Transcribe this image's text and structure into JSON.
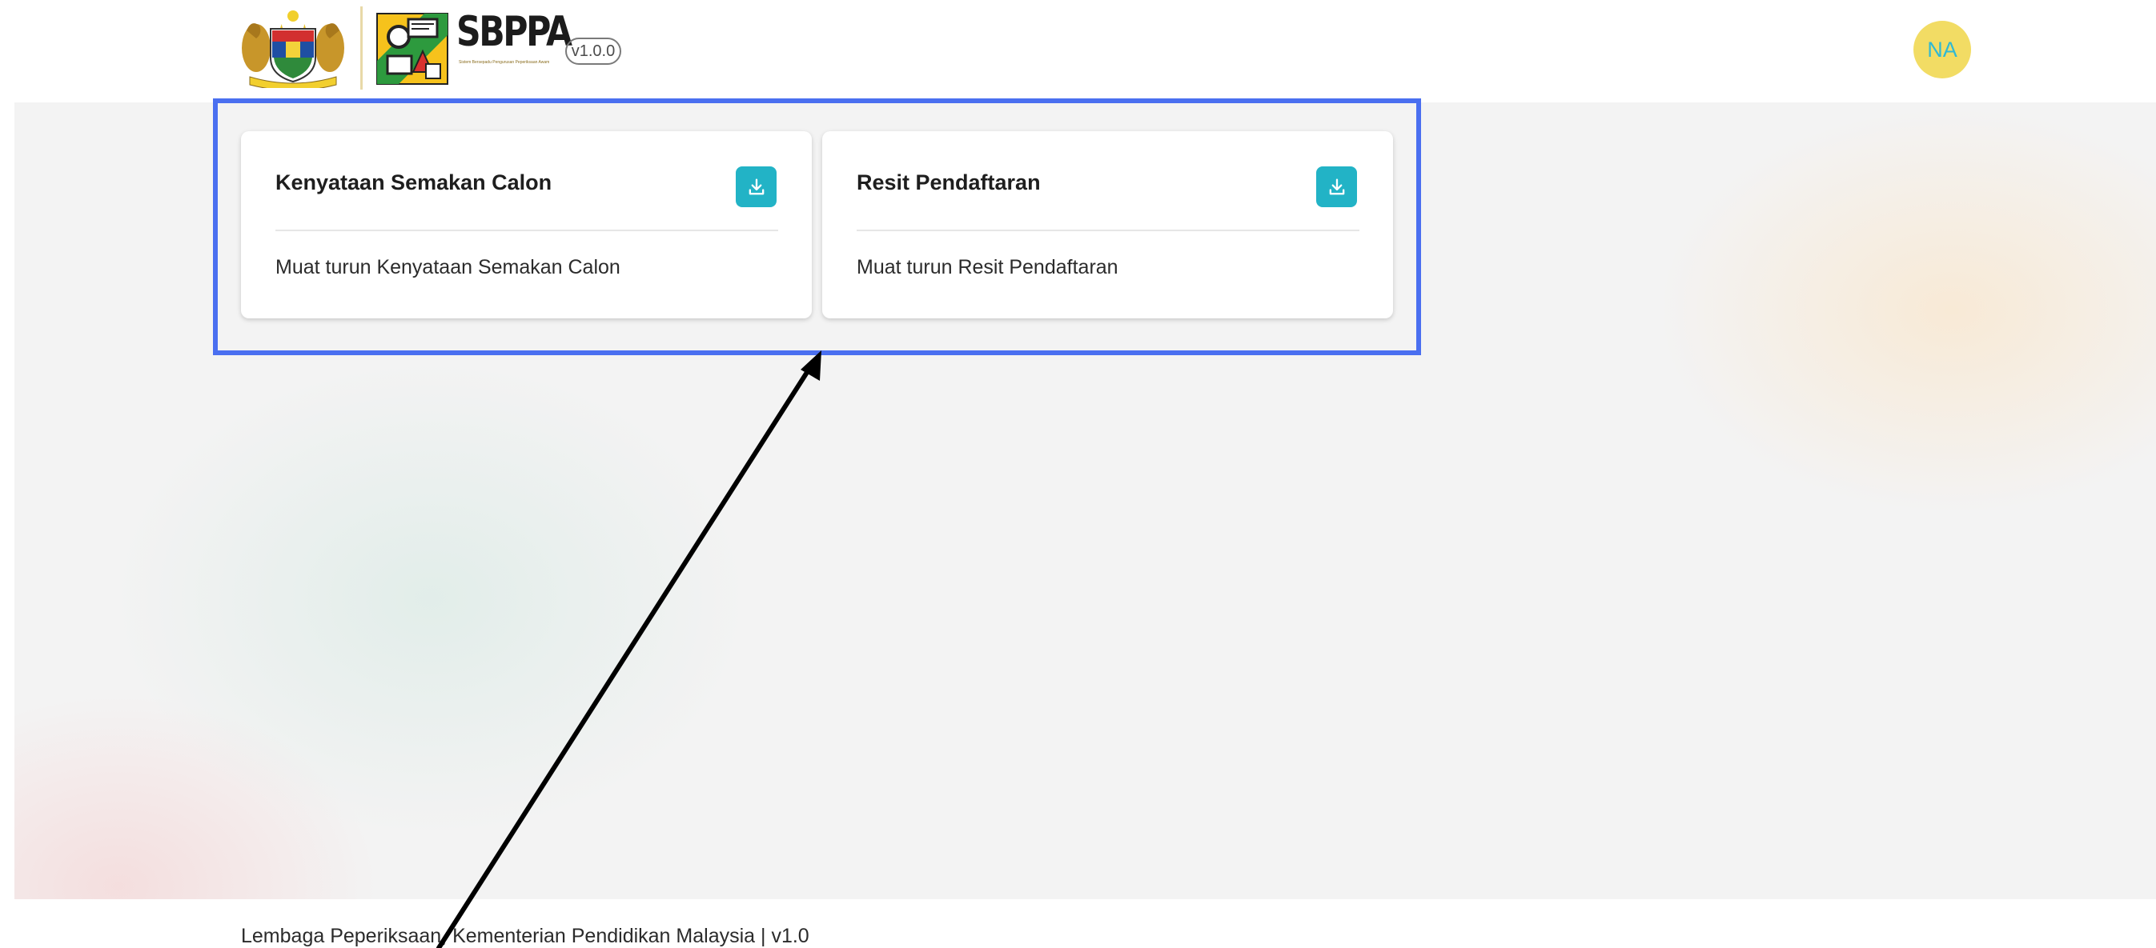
{
  "header": {
    "app_name": "SBPPA",
    "app_subtitle": "Sistem Bersepadu Pengurusan Peperiksaan Awam",
    "version_badge": "v1.0.0",
    "avatar_initials": "NA"
  },
  "cards": [
    {
      "title": "Kenyataan Semakan Calon",
      "description": "Muat turun Kenyataan Semakan Calon",
      "action_icon": "download-icon"
    },
    {
      "title": "Resit Pendaftaran",
      "description": "Muat turun Resit Pendaftaran",
      "action_icon": "download-icon"
    }
  ],
  "footer": {
    "text": "Lembaga Peperiksaan, Kementerian Pendidikan Malaysia | v1.0"
  },
  "colors": {
    "accent": "#22b3c6",
    "avatar_bg": "#f2dc64",
    "highlight_border": "#4a6ff0",
    "annotation_arrow": "#000000"
  }
}
